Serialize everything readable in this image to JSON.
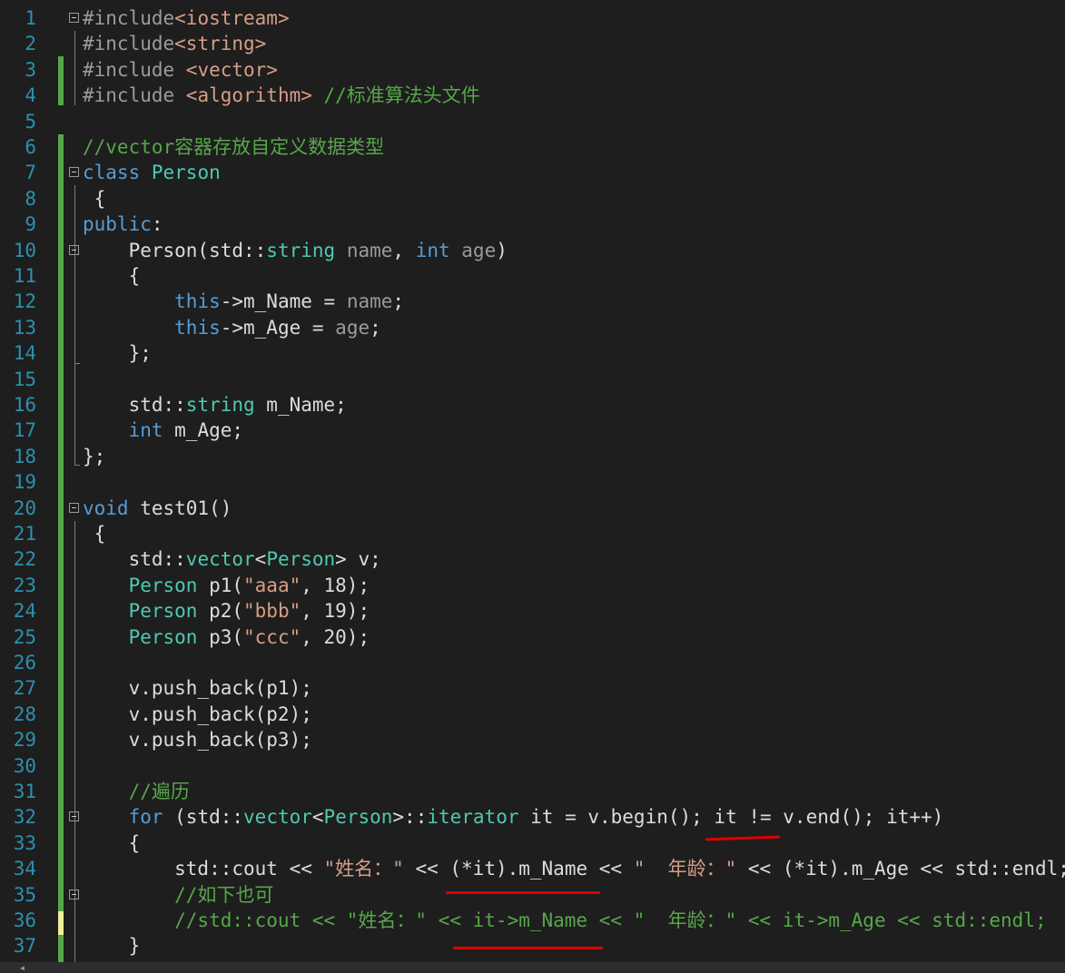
{
  "editor": {
    "lines": [
      {
        "n": "1",
        "segs": [
          {
            "t": "#include",
            "c": "pp"
          },
          {
            "t": "<iostream>",
            "c": "inc"
          }
        ]
      },
      {
        "n": "2",
        "segs": [
          {
            "t": "#include",
            "c": "pp"
          },
          {
            "t": "<string>",
            "c": "inc"
          }
        ]
      },
      {
        "n": "3",
        "segs": [
          {
            "t": "#include ",
            "c": "pp"
          },
          {
            "t": "<vector>",
            "c": "inc"
          }
        ]
      },
      {
        "n": "4",
        "segs": [
          {
            "t": "#include ",
            "c": "pp"
          },
          {
            "t": "<algorithm>",
            "c": "inc"
          },
          {
            "t": " //标准算法头文件",
            "c": "cmt"
          }
        ]
      },
      {
        "n": "5",
        "segs": []
      },
      {
        "n": "6",
        "segs": [
          {
            "t": "//vector容器存放自定义数据类型",
            "c": "cmt"
          }
        ]
      },
      {
        "n": "7",
        "segs": [
          {
            "t": "class",
            "c": "kw"
          },
          {
            "t": " "
          },
          {
            "t": "Person",
            "c": "ty"
          }
        ]
      },
      {
        "n": "8",
        "segs": [
          {
            "t": " {"
          }
        ]
      },
      {
        "n": "9",
        "segs": [
          {
            "t": "public",
            "c": "kw"
          },
          {
            "t": ":"
          }
        ]
      },
      {
        "n": "10",
        "segs": [
          {
            "t": "    Person(std::"
          },
          {
            "t": "string",
            "c": "ty"
          },
          {
            "t": " "
          },
          {
            "t": "name",
            "c": "par"
          },
          {
            "t": ", "
          },
          {
            "t": "int",
            "c": "kw"
          },
          {
            "t": " "
          },
          {
            "t": "age",
            "c": "par"
          },
          {
            "t": ")"
          }
        ]
      },
      {
        "n": "11",
        "segs": [
          {
            "t": "    {"
          }
        ]
      },
      {
        "n": "12",
        "segs": [
          {
            "t": "        "
          },
          {
            "t": "this",
            "c": "kw"
          },
          {
            "t": "->m_Name = "
          },
          {
            "t": "name",
            "c": "par"
          },
          {
            "t": ";"
          }
        ]
      },
      {
        "n": "13",
        "segs": [
          {
            "t": "        "
          },
          {
            "t": "this",
            "c": "kw"
          },
          {
            "t": "->m_Age = "
          },
          {
            "t": "age",
            "c": "par"
          },
          {
            "t": ";"
          }
        ]
      },
      {
        "n": "14",
        "segs": [
          {
            "t": "    };"
          }
        ]
      },
      {
        "n": "15",
        "segs": []
      },
      {
        "n": "16",
        "segs": [
          {
            "t": "    std::"
          },
          {
            "t": "string",
            "c": "ty"
          },
          {
            "t": " m_Name;"
          }
        ]
      },
      {
        "n": "17",
        "segs": [
          {
            "t": "    "
          },
          {
            "t": "int",
            "c": "kw"
          },
          {
            "t": " m_Age;"
          }
        ]
      },
      {
        "n": "18",
        "segs": [
          {
            "t": "};"
          }
        ]
      },
      {
        "n": "19",
        "segs": []
      },
      {
        "n": "20",
        "segs": [
          {
            "t": "void",
            "c": "kw"
          },
          {
            "t": " test01()"
          }
        ]
      },
      {
        "n": "21",
        "segs": [
          {
            "t": " {"
          }
        ]
      },
      {
        "n": "22",
        "segs": [
          {
            "t": "    std::"
          },
          {
            "t": "vector",
            "c": "ty"
          },
          {
            "t": "<"
          },
          {
            "t": "Person",
            "c": "ty"
          },
          {
            "t": "> v;"
          }
        ]
      },
      {
        "n": "23",
        "segs": [
          {
            "t": "    "
          },
          {
            "t": "Person",
            "c": "ty"
          },
          {
            "t": " p1("
          },
          {
            "t": "\"aaa\"",
            "c": "str"
          },
          {
            "t": ", 18);"
          }
        ]
      },
      {
        "n": "24",
        "segs": [
          {
            "t": "    "
          },
          {
            "t": "Person",
            "c": "ty"
          },
          {
            "t": " p2("
          },
          {
            "t": "\"bbb\"",
            "c": "str"
          },
          {
            "t": ", 19);"
          }
        ]
      },
      {
        "n": "25",
        "segs": [
          {
            "t": "    "
          },
          {
            "t": "Person",
            "c": "ty"
          },
          {
            "t": " p3("
          },
          {
            "t": "\"ccc\"",
            "c": "str"
          },
          {
            "t": ", 20);"
          }
        ]
      },
      {
        "n": "26",
        "segs": []
      },
      {
        "n": "27",
        "segs": [
          {
            "t": "    v.push_back(p1);"
          }
        ]
      },
      {
        "n": "28",
        "segs": [
          {
            "t": "    v.push_back(p2);"
          }
        ]
      },
      {
        "n": "29",
        "segs": [
          {
            "t": "    v.push_back(p3);"
          }
        ]
      },
      {
        "n": "30",
        "segs": []
      },
      {
        "n": "31",
        "segs": [
          {
            "t": "    //遍历",
            "c": "cmt"
          }
        ]
      },
      {
        "n": "32",
        "segs": [
          {
            "t": "    "
          },
          {
            "t": "for",
            "c": "kw"
          },
          {
            "t": " (std::"
          },
          {
            "t": "vector",
            "c": "ty"
          },
          {
            "t": "<"
          },
          {
            "t": "Person",
            "c": "ty"
          },
          {
            "t": ">::"
          },
          {
            "t": "iterator",
            "c": "ty"
          },
          {
            "t": " it = v.begin(); it != v.end(); it++)"
          }
        ]
      },
      {
        "n": "33",
        "segs": [
          {
            "t": "    {"
          }
        ]
      },
      {
        "n": "34",
        "segs": [
          {
            "t": "        std::cout << "
          },
          {
            "t": "\"姓名：\"",
            "c": "str"
          },
          {
            "t": " << (*it).m_Name << "
          },
          {
            "t": "\"  年龄：\"",
            "c": "str"
          },
          {
            "t": " << (*it).m_Age << std::endl;"
          }
        ]
      },
      {
        "n": "35",
        "segs": [
          {
            "t": "        //如下也可",
            "c": "cmt"
          }
        ]
      },
      {
        "n": "36",
        "segs": [
          {
            "t": "        //std::cout << \"姓名：\" << it->m_Name << \"  年龄：\" << it->m_Age << std::endl;",
            "c": "cmt"
          }
        ]
      },
      {
        "n": "37",
        "segs": [
          {
            "t": "    }"
          }
        ]
      }
    ]
  },
  "colors": {
    "background": "#1e1e1e",
    "line_number": "#2b91af",
    "keyword": "#569cd6",
    "type": "#4ec9b0",
    "string": "#d69d85",
    "comment": "#57a64a",
    "annotation_underline": "#e00000"
  }
}
